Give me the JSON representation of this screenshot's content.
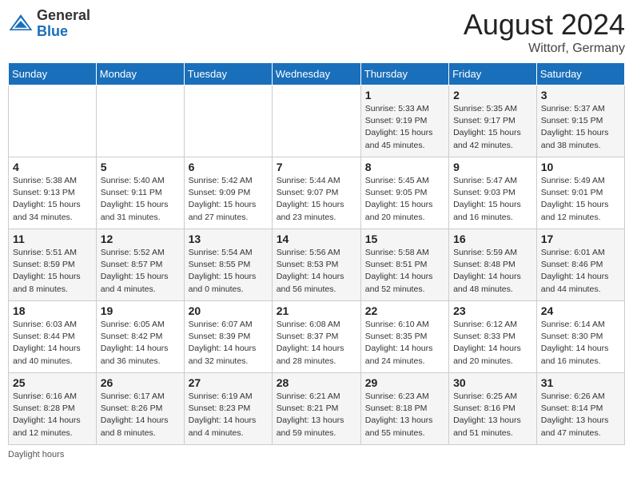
{
  "header": {
    "logo_general": "General",
    "logo_blue": "Blue",
    "month_year": "August 2024",
    "location": "Wittorf, Germany"
  },
  "days_of_week": [
    "Sunday",
    "Monday",
    "Tuesday",
    "Wednesday",
    "Thursday",
    "Friday",
    "Saturday"
  ],
  "weeks": [
    [
      {
        "day": "",
        "info": ""
      },
      {
        "day": "",
        "info": ""
      },
      {
        "day": "",
        "info": ""
      },
      {
        "day": "",
        "info": ""
      },
      {
        "day": "1",
        "info": "Sunrise: 5:33 AM\nSunset: 9:19 PM\nDaylight: 15 hours and 45 minutes."
      },
      {
        "day": "2",
        "info": "Sunrise: 5:35 AM\nSunset: 9:17 PM\nDaylight: 15 hours and 42 minutes."
      },
      {
        "day": "3",
        "info": "Sunrise: 5:37 AM\nSunset: 9:15 PM\nDaylight: 15 hours and 38 minutes."
      }
    ],
    [
      {
        "day": "4",
        "info": "Sunrise: 5:38 AM\nSunset: 9:13 PM\nDaylight: 15 hours and 34 minutes."
      },
      {
        "day": "5",
        "info": "Sunrise: 5:40 AM\nSunset: 9:11 PM\nDaylight: 15 hours and 31 minutes."
      },
      {
        "day": "6",
        "info": "Sunrise: 5:42 AM\nSunset: 9:09 PM\nDaylight: 15 hours and 27 minutes."
      },
      {
        "day": "7",
        "info": "Sunrise: 5:44 AM\nSunset: 9:07 PM\nDaylight: 15 hours and 23 minutes."
      },
      {
        "day": "8",
        "info": "Sunrise: 5:45 AM\nSunset: 9:05 PM\nDaylight: 15 hours and 20 minutes."
      },
      {
        "day": "9",
        "info": "Sunrise: 5:47 AM\nSunset: 9:03 PM\nDaylight: 15 hours and 16 minutes."
      },
      {
        "day": "10",
        "info": "Sunrise: 5:49 AM\nSunset: 9:01 PM\nDaylight: 15 hours and 12 minutes."
      }
    ],
    [
      {
        "day": "11",
        "info": "Sunrise: 5:51 AM\nSunset: 8:59 PM\nDaylight: 15 hours and 8 minutes."
      },
      {
        "day": "12",
        "info": "Sunrise: 5:52 AM\nSunset: 8:57 PM\nDaylight: 15 hours and 4 minutes."
      },
      {
        "day": "13",
        "info": "Sunrise: 5:54 AM\nSunset: 8:55 PM\nDaylight: 15 hours and 0 minutes."
      },
      {
        "day": "14",
        "info": "Sunrise: 5:56 AM\nSunset: 8:53 PM\nDaylight: 14 hours and 56 minutes."
      },
      {
        "day": "15",
        "info": "Sunrise: 5:58 AM\nSunset: 8:51 PM\nDaylight: 14 hours and 52 minutes."
      },
      {
        "day": "16",
        "info": "Sunrise: 5:59 AM\nSunset: 8:48 PM\nDaylight: 14 hours and 48 minutes."
      },
      {
        "day": "17",
        "info": "Sunrise: 6:01 AM\nSunset: 8:46 PM\nDaylight: 14 hours and 44 minutes."
      }
    ],
    [
      {
        "day": "18",
        "info": "Sunrise: 6:03 AM\nSunset: 8:44 PM\nDaylight: 14 hours and 40 minutes."
      },
      {
        "day": "19",
        "info": "Sunrise: 6:05 AM\nSunset: 8:42 PM\nDaylight: 14 hours and 36 minutes."
      },
      {
        "day": "20",
        "info": "Sunrise: 6:07 AM\nSunset: 8:39 PM\nDaylight: 14 hours and 32 minutes."
      },
      {
        "day": "21",
        "info": "Sunrise: 6:08 AM\nSunset: 8:37 PM\nDaylight: 14 hours and 28 minutes."
      },
      {
        "day": "22",
        "info": "Sunrise: 6:10 AM\nSunset: 8:35 PM\nDaylight: 14 hours and 24 minutes."
      },
      {
        "day": "23",
        "info": "Sunrise: 6:12 AM\nSunset: 8:33 PM\nDaylight: 14 hours and 20 minutes."
      },
      {
        "day": "24",
        "info": "Sunrise: 6:14 AM\nSunset: 8:30 PM\nDaylight: 14 hours and 16 minutes."
      }
    ],
    [
      {
        "day": "25",
        "info": "Sunrise: 6:16 AM\nSunset: 8:28 PM\nDaylight: 14 hours and 12 minutes."
      },
      {
        "day": "26",
        "info": "Sunrise: 6:17 AM\nSunset: 8:26 PM\nDaylight: 14 hours and 8 minutes."
      },
      {
        "day": "27",
        "info": "Sunrise: 6:19 AM\nSunset: 8:23 PM\nDaylight: 14 hours and 4 minutes."
      },
      {
        "day": "28",
        "info": "Sunrise: 6:21 AM\nSunset: 8:21 PM\nDaylight: 13 hours and 59 minutes."
      },
      {
        "day": "29",
        "info": "Sunrise: 6:23 AM\nSunset: 8:18 PM\nDaylight: 13 hours and 55 minutes."
      },
      {
        "day": "30",
        "info": "Sunrise: 6:25 AM\nSunset: 8:16 PM\nDaylight: 13 hours and 51 minutes."
      },
      {
        "day": "31",
        "info": "Sunrise: 6:26 AM\nSunset: 8:14 PM\nDaylight: 13 hours and 47 minutes."
      }
    ]
  ],
  "footer": {
    "note": "Daylight hours"
  }
}
